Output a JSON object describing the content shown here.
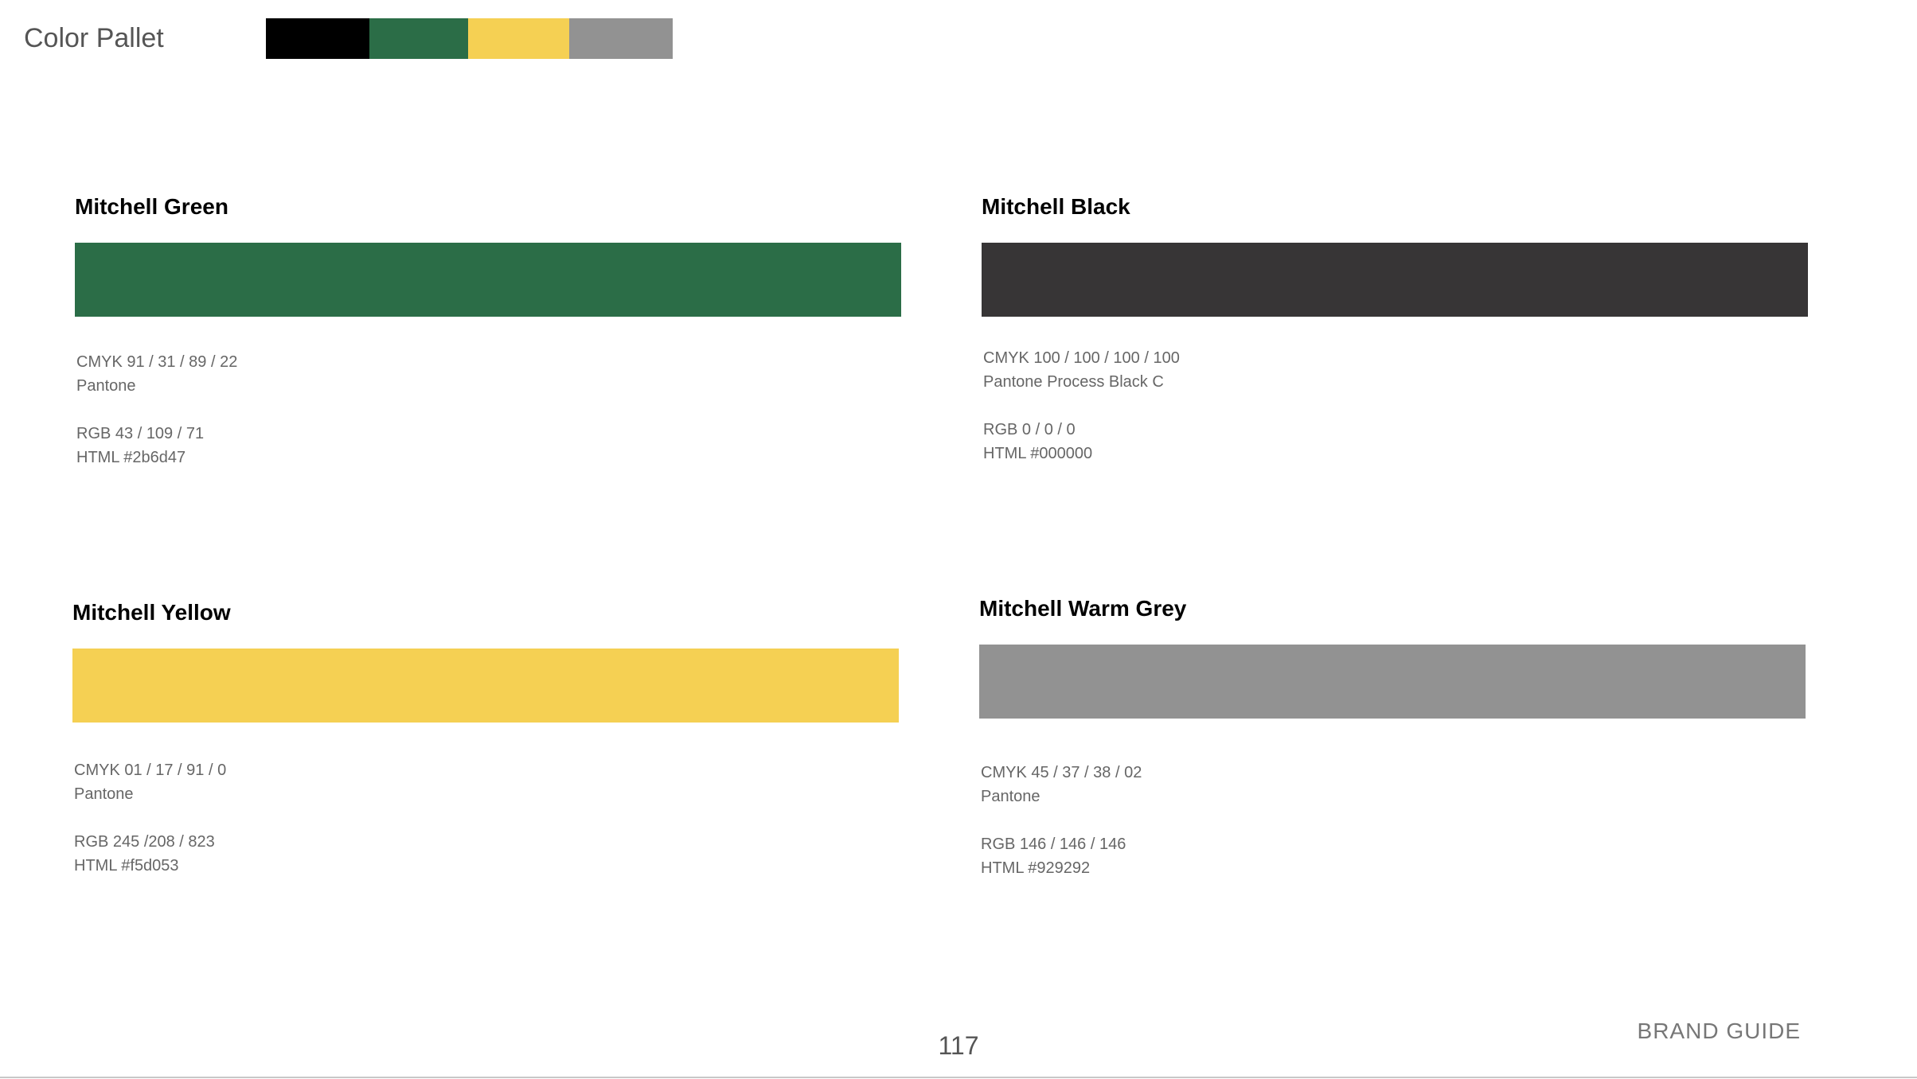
{
  "header": {
    "title": "Color Pallet",
    "palette": [
      "#000000",
      "#2b6d47",
      "#f5d053",
      "#929292"
    ]
  },
  "swatches": [
    {
      "name": "Mitchell Green",
      "color": "#2b6d47",
      "cmyk": "CMYK 91 / 31 / 89 / 22",
      "pantone": "Pantone",
      "rgb": "RGB 43 / 109 / 71",
      "html": "HTML #2b6d47"
    },
    {
      "name": "Mitchell Black",
      "color": "#373536",
      "cmyk": "CMYK 100 / 100 / 100 / 100",
      "pantone": "Pantone Process Black C",
      "rgb": "RGB 0 / 0 / 0",
      "html": "HTML #000000"
    },
    {
      "name": "Mitchell Yellow",
      "color": "#f5d053",
      "cmyk": "CMYK 01 / 17 / 91 / 0",
      "pantone": "Pantone",
      "rgb": "RGB 245 /208 / 823",
      "html": "HTML #f5d053"
    },
    {
      "name": "Mitchell Warm Grey",
      "color": "#929292",
      "cmyk": "CMYK 45 / 37 / 38 / 02",
      "pantone": "Pantone",
      "rgb": "RGB 146 / 146 / 146",
      "html": "HTML #929292"
    }
  ],
  "footer": {
    "page_number": "117",
    "brand_label": "BRAND GUIDE"
  }
}
